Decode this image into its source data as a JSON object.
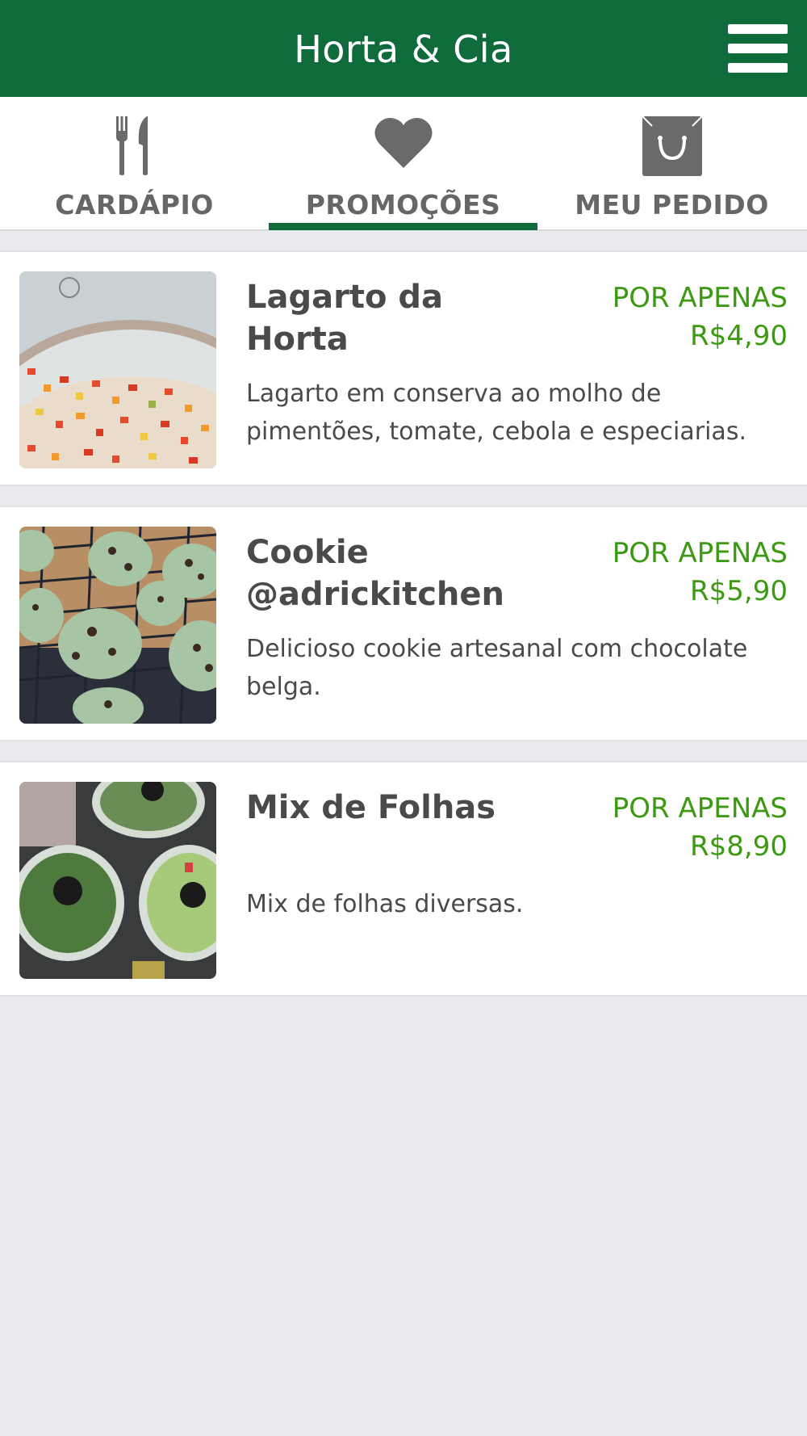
{
  "header": {
    "title": "Horta & Cia",
    "menu_icon": "hamburger-menu-icon",
    "background_color": "#0f6b3c"
  },
  "tabs": [
    {
      "label": "CARDÁPIO",
      "icon": "fork-knife-icon",
      "active": false
    },
    {
      "label": "PROMOÇÕES",
      "icon": "heart-icon",
      "active": true
    },
    {
      "label": "MEU PEDIDO",
      "icon": "shopping-bag-icon",
      "active": false
    }
  ],
  "promotions": [
    {
      "name": "Lagarto da Horta",
      "price_prefix": "POR APENAS",
      "price": "R$4,90",
      "description": "Lagarto em conserva ao molho de pimentões, tomate, cebola e especiarias.",
      "image": "lagarto-dish-photo"
    },
    {
      "name": "Cookie @adrickitchen",
      "price_prefix": "POR APENAS",
      "price": "R$5,90",
      "description": "Delicioso cookie artesanal com chocolate belga.",
      "image": "cookies-photo"
    },
    {
      "name": "Mix de Folhas",
      "price_prefix": "POR APENAS",
      "price": "R$8,90",
      "description": "Mix de folhas diversas.",
      "image": "salad-containers-photo"
    }
  ],
  "colors": {
    "accent": "#0f6b3c",
    "price": "#3c9a12",
    "text": "#4a4a4a",
    "tab_text": "#666666",
    "page_background": "#e9eaed"
  }
}
